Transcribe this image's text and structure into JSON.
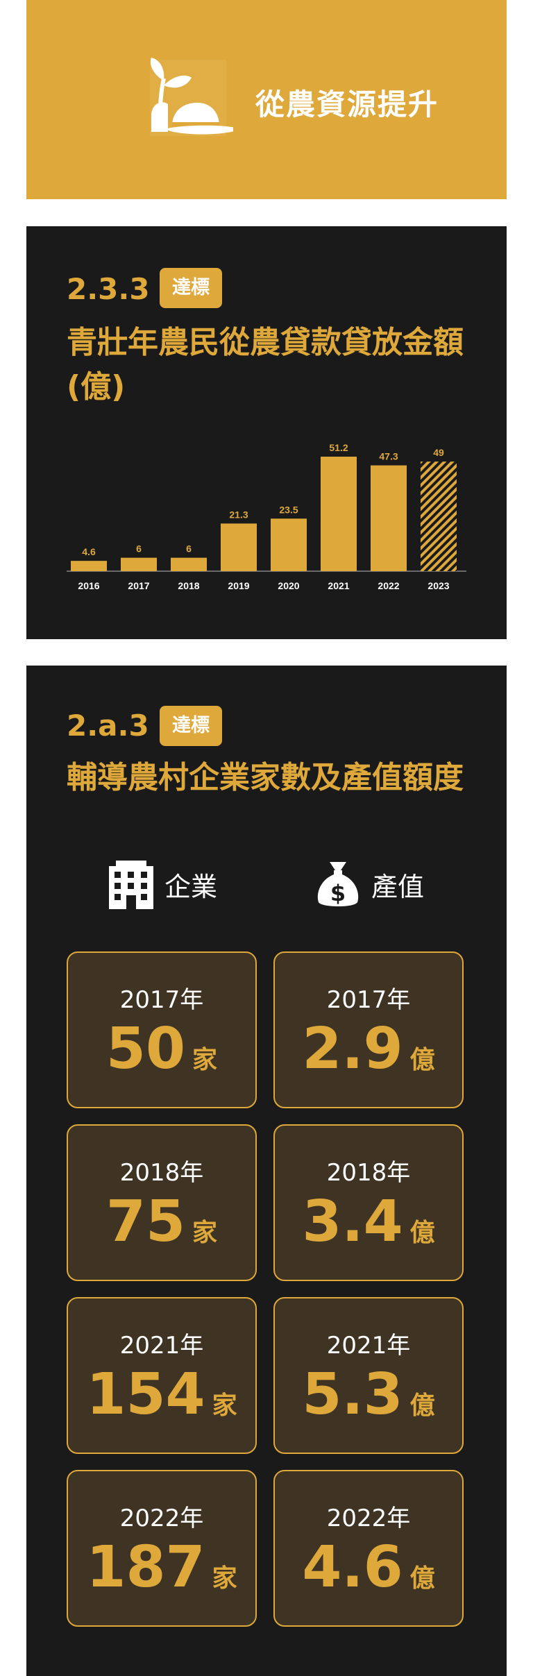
{
  "header": {
    "title": "從農資源提升",
    "icon": "sprout-hat-icon",
    "bg_color": "#dea93a"
  },
  "section1": {
    "code": "2.3.3",
    "badge": "達標",
    "title": "青壯年農民從農貸款貸放金額(億)",
    "chart_data": {
      "type": "bar",
      "categories": [
        "2016",
        "2017",
        "2018",
        "2019",
        "2020",
        "2021",
        "2022",
        "2023"
      ],
      "values": [
        4.6,
        6,
        6,
        21.3,
        23.5,
        51.2,
        47.3,
        49
      ],
      "data_labels": [
        "4.6",
        "6",
        "6",
        "21.3",
        "23.5",
        "51.2",
        "47.3",
        "49"
      ],
      "hatched_category": "2023",
      "bar_color": "#dea93a",
      "title": "",
      "xlabel": "",
      "ylabel": "",
      "ylim": [
        0,
        51.2
      ],
      "grid": false
    }
  },
  "section2": {
    "code": "2.a.3",
    "badge": "達標",
    "title": "輔導農村企業家數及產值額度",
    "enterprise_label": "企業",
    "enterprise_icon": "building-icon",
    "value_label": "產值",
    "value_icon": "money-bag-icon",
    "enterprises": [
      {
        "year": "2017年",
        "value": "50",
        "unit": "家"
      },
      {
        "year": "2018年",
        "value": "75",
        "unit": "家"
      },
      {
        "year": "2021年",
        "value": "154",
        "unit": "家"
      },
      {
        "year": "2022年",
        "value": "187",
        "unit": "家"
      }
    ],
    "output": [
      {
        "year": "2017年",
        "value": "2.9",
        "unit": "億"
      },
      {
        "year": "2018年",
        "value": "3.4",
        "unit": "億"
      },
      {
        "year": "2021年",
        "value": "5.3",
        "unit": "億"
      },
      {
        "year": "2022年",
        "value": "4.6",
        "unit": "億"
      }
    ]
  }
}
